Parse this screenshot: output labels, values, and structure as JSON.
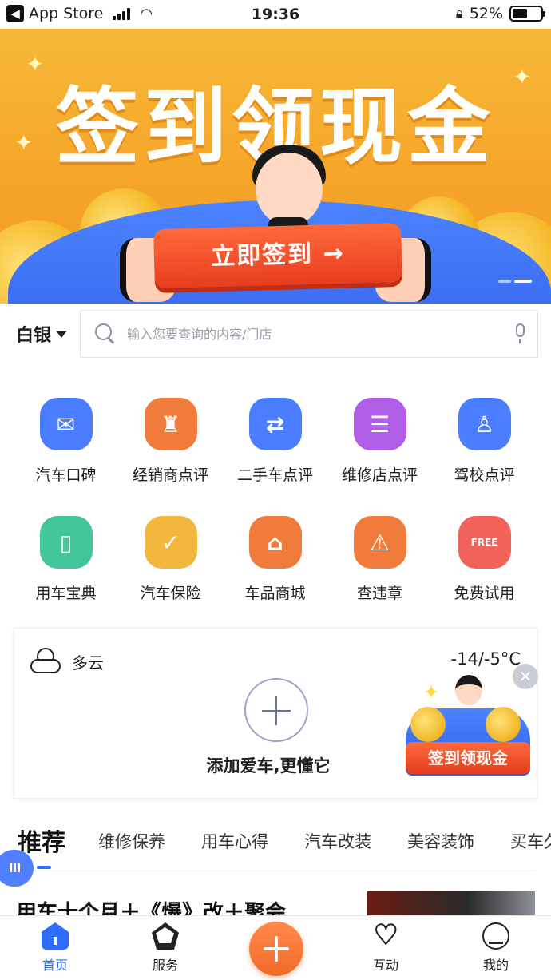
{
  "status_bar": {
    "carrier": "App Store",
    "time": "19:36",
    "battery": "52%",
    "battery_level": 0.52
  },
  "banner": {
    "title": "签到领现金",
    "cta": "立即签到 →"
  },
  "search": {
    "tier_label": "白银",
    "placeholder": "输入您要查询的内容/门店"
  },
  "shortcuts": [
    {
      "label": "汽车口碑",
      "icon": "mail-icon",
      "color": "#4a7dff"
    },
    {
      "label": "经销商点评",
      "icon": "tie-icon",
      "color": "#f07b3a"
    },
    {
      "label": "二手车点评",
      "icon": "car-swap-icon",
      "color": "#4a7dff"
    },
    {
      "label": "维修店点评",
      "icon": "comment-icon",
      "color": "#b05ee8"
    },
    {
      "label": "驾校点评",
      "icon": "driver-icon",
      "color": "#4a7dff"
    },
    {
      "label": "用车宝典",
      "icon": "book-icon",
      "color": "#43c79a"
    },
    {
      "label": "汽车保险",
      "icon": "car-shield-icon",
      "color": "#f4b73e"
    },
    {
      "label": "车品商城",
      "icon": "store-icon",
      "color": "#f07b3a"
    },
    {
      "label": "查违章",
      "icon": "warning-icon",
      "color": "#f07b3a"
    },
    {
      "label": "免费试用",
      "icon": "free-ticket-icon",
      "color": "#f0625a"
    }
  ],
  "card": {
    "weather": "多云",
    "temperature": "-14/-5°C",
    "add_car": "添加爱车,更懂它",
    "promo": "签到领现金"
  },
  "tabs": [
    "推荐",
    "维修保养",
    "用车心得",
    "汽车改装",
    "美容装饰",
    "买车久"
  ],
  "float_handle": "III",
  "article": {
    "title": "用车十个月＋《爆》改＋聚会"
  },
  "nav": {
    "home": "首页",
    "service": "服务",
    "interact": "互动",
    "me": "我的"
  }
}
